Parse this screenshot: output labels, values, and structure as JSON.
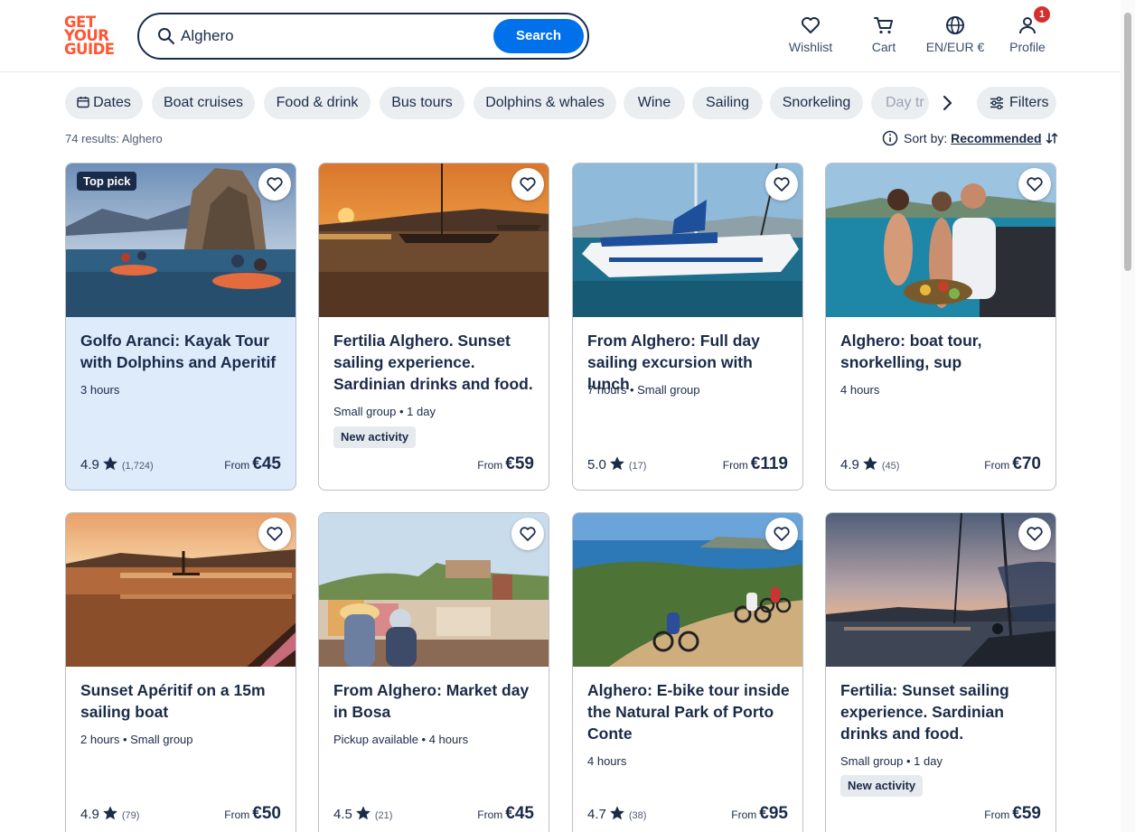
{
  "logo": [
    "GET",
    "YOUR",
    "GUIDE"
  ],
  "search": {
    "value": "Alghero",
    "button": "Search"
  },
  "nav": {
    "wishlist": "Wishlist",
    "cart": "Cart",
    "language": "EN/EUR €",
    "profile": "Profile",
    "profile_badge": "1"
  },
  "chips": [
    "Dates",
    "Boat cruises",
    "Food & drink",
    "Bus tours",
    "Dolphins & whales",
    "Wine",
    "Sailing",
    "Snorkeling",
    "Day tr"
  ],
  "filters_label": "Filters",
  "results_text": "74 results: Alghero",
  "sort": {
    "label": "Sort by:",
    "value": "Recommended"
  },
  "cards": [
    {
      "title": "Golfo Aranci: Kayak Tour with Dolphins and Aperitif",
      "meta": "3 hours",
      "badge": "Top pick",
      "rating": "4.9",
      "count": "(1,724)",
      "from": "From",
      "price": "€45",
      "new": ""
    },
    {
      "title": "Fertilia Alghero. Sunset sailing experience. Sardinian drinks and food.",
      "meta": "Small group • 1 day",
      "badge": "",
      "rating": "",
      "count": "",
      "from": "From",
      "price": "€59",
      "new": "New activity"
    },
    {
      "title": "From Alghero: Full day sailing excursion with lunch",
      "meta": "7 hours • Small group",
      "badge": "",
      "rating": "5.0",
      "count": "(17)",
      "from": "From",
      "price": "€119",
      "new": ""
    },
    {
      "title": "Alghero: boat tour, snorkelling, sup",
      "meta": "4 hours",
      "badge": "",
      "rating": "4.9",
      "count": "(45)",
      "from": "From",
      "price": "€70",
      "new": ""
    },
    {
      "title": "Sunset Apéritif on a 15m sailing boat",
      "meta": "2 hours • Small group",
      "badge": "",
      "rating": "4.9",
      "count": "(79)",
      "from": "From",
      "price": "€50",
      "new": ""
    },
    {
      "title": "From Alghero: Market day in Bosa",
      "meta": "Pickup available • 4 hours",
      "badge": "",
      "rating": "4.5",
      "count": "(21)",
      "from": "From",
      "price": "€45",
      "new": ""
    },
    {
      "title": "Alghero: E-bike tour inside the Natural Park of Porto Conte",
      "meta": "4 hours",
      "badge": "",
      "rating": "4.7",
      "count": "(38)",
      "from": "From",
      "price": "€95",
      "new": ""
    },
    {
      "title": "Fertilia: Sunset sailing experience. Sardinian drinks and food.",
      "meta": "Small group • 1 day",
      "badge": "",
      "rating": "",
      "count": "",
      "from": "From",
      "price": "€59",
      "new": "New activity"
    }
  ],
  "colors": {
    "brand": "#ff5533",
    "accent": "#0071eb",
    "text": "#1a2b49",
    "highlight": "#ddebfb"
  }
}
